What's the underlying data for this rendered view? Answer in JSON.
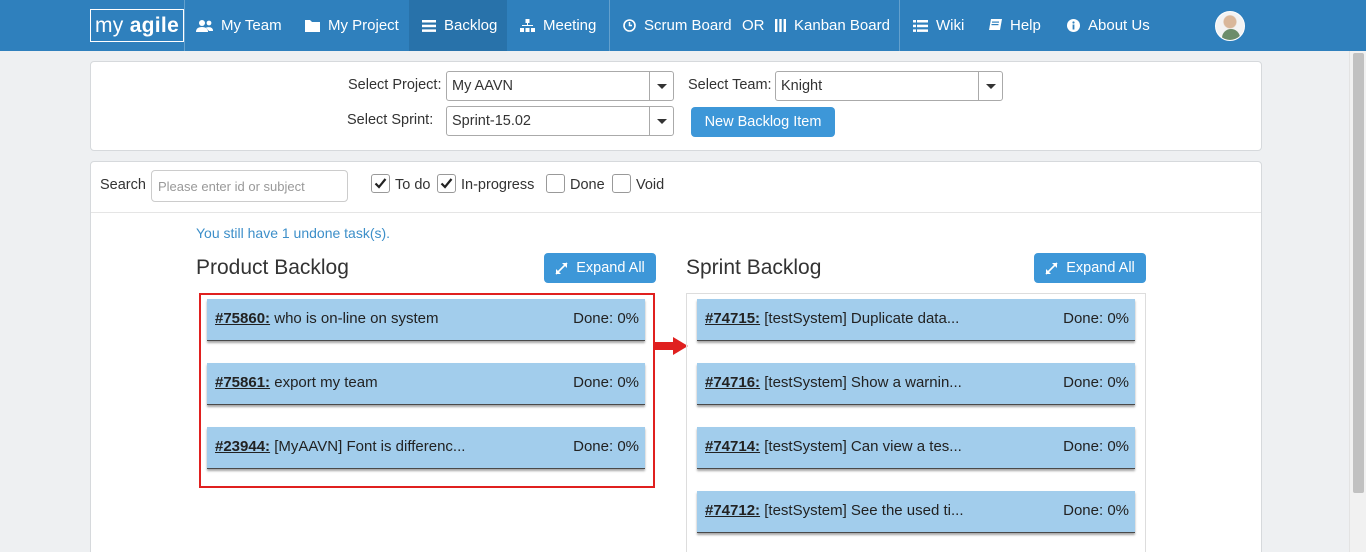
{
  "nav": {
    "brand_light": "my ",
    "brand_bold": "agile",
    "items": [
      {
        "label": "My Team",
        "icon": "users-icon"
      },
      {
        "label": "My Project",
        "icon": "folder-icon"
      },
      {
        "label": "Backlog",
        "icon": "list-icon",
        "active": true
      },
      {
        "label": "Meeting",
        "icon": "sitemap-icon"
      },
      {
        "label": "Scrum Board",
        "icon": "clock-icon"
      },
      {
        "label": "OR"
      },
      {
        "label": "Kanban Board",
        "icon": "columns-icon"
      },
      {
        "label": "Wiki",
        "icon": "list-icon"
      },
      {
        "label": "Help",
        "icon": "book-icon"
      },
      {
        "label": "About Us",
        "icon": "info-icon"
      }
    ]
  },
  "filters": {
    "project_label": "Select Project:",
    "project_value": "My AAVN",
    "team_label": "Select Team:",
    "team_value": "Knight",
    "sprint_label": "Select Sprint:",
    "sprint_value": "Sprint-15.02",
    "new_item_label": "New Backlog Item"
  },
  "board": {
    "search_label": "Search",
    "search_placeholder": "Please enter id or subject",
    "status_filters": [
      {
        "label": "To do",
        "checked": true
      },
      {
        "label": "In-progress",
        "checked": true
      },
      {
        "label": "Done",
        "checked": false
      },
      {
        "label": "Void",
        "checked": false
      }
    ],
    "notice": "You still have 1 undone task(s).",
    "expand_all_label": "Expand All",
    "product_backlog": {
      "title": "Product Backlog",
      "items": [
        {
          "id": "#75860:",
          "subject": "who is on-line on system",
          "done": "Done: 0%"
        },
        {
          "id": "#75861:",
          "subject": "export my team",
          "done": "Done: 0%"
        },
        {
          "id": "#23944:",
          "subject": "[MyAAVN] Font is differenc...",
          "done": "Done: 0%"
        }
      ]
    },
    "sprint_backlog": {
      "title": "Sprint Backlog",
      "items": [
        {
          "id": "#74715:",
          "subject": "[testSystem] Duplicate data...",
          "done": "Done: 0%"
        },
        {
          "id": "#74716:",
          "subject": "[testSystem] Show a warnin...",
          "done": "Done: 0%"
        },
        {
          "id": "#74714:",
          "subject": "[testSystem] Can view a tes...",
          "done": "Done: 0%"
        },
        {
          "id": "#74712:",
          "subject": "[testSystem] See the used ti...",
          "done": "Done: 0%"
        }
      ]
    }
  },
  "colors": {
    "navbar": "#2f80bd",
    "card": "#a2cdec",
    "button": "#3d97d8",
    "highlight": "#e0201f"
  }
}
